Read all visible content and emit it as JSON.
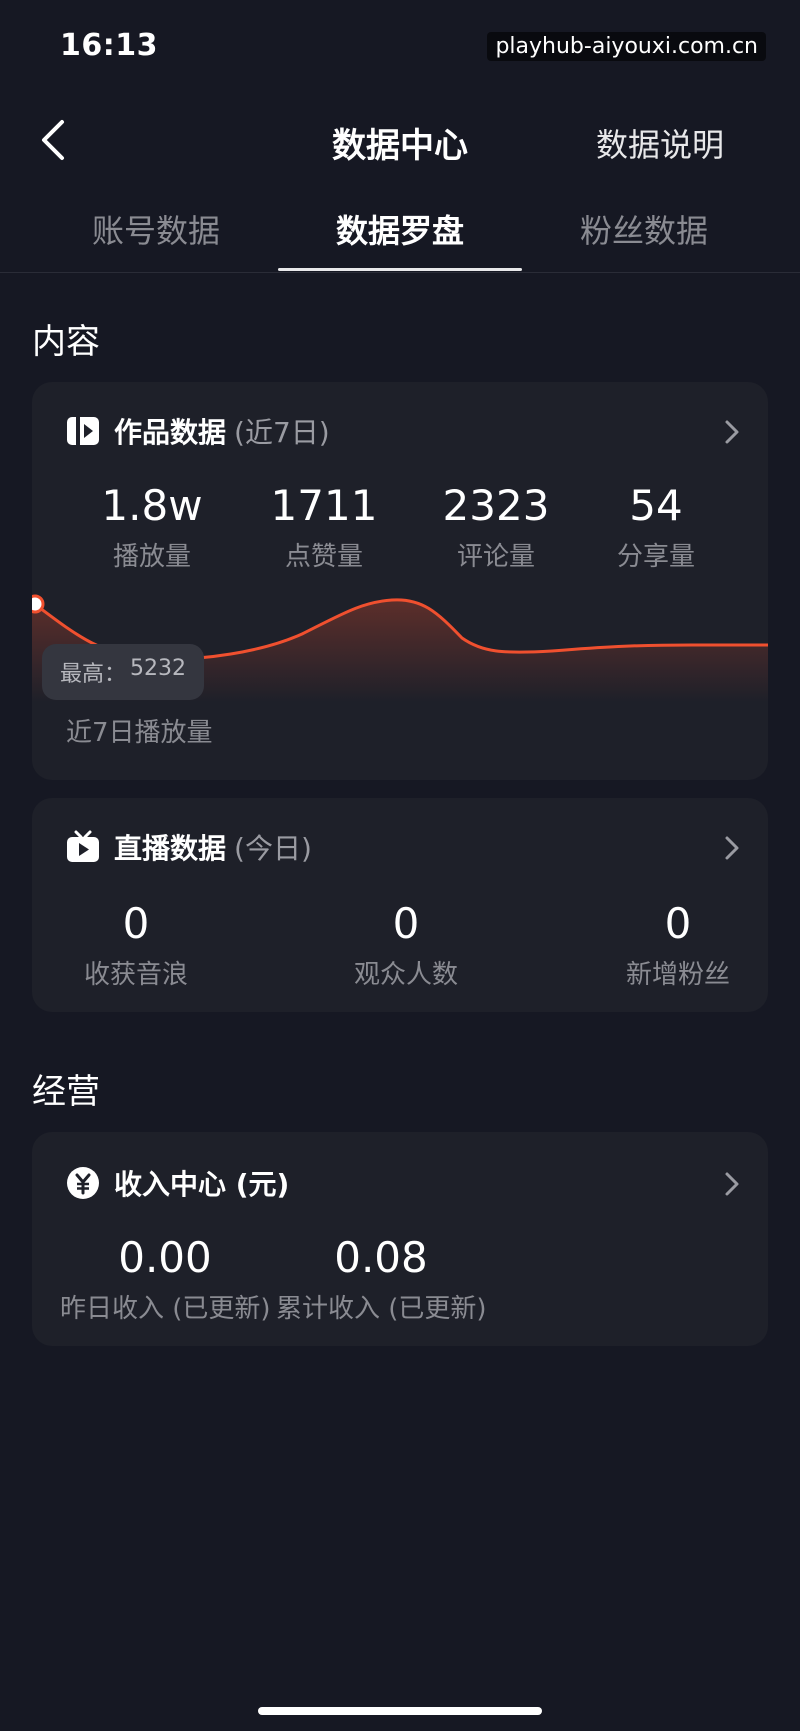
{
  "status": {
    "time": "16:13",
    "watermark": "playhub-aiyouxi.com.cn"
  },
  "header": {
    "title": "数据中心",
    "right_link": "数据说明"
  },
  "tabs": [
    {
      "label": "账号数据",
      "active": false
    },
    {
      "label": "数据罗盘",
      "active": true
    },
    {
      "label": "粉丝数据",
      "active": false
    }
  ],
  "content_section": {
    "title": "内容"
  },
  "works_card": {
    "title": "作品数据",
    "suffix": "(近7日)",
    "metrics": [
      {
        "value": "1.8w",
        "label": "播放量"
      },
      {
        "value": "1711",
        "label": "点赞量"
      },
      {
        "value": "2323",
        "label": "评论量"
      },
      {
        "value": "54",
        "label": "分享量"
      }
    ],
    "chart": {
      "tooltip_label": "最高：",
      "tooltip_value": "5232",
      "caption": "近7日播放量",
      "line_color": "#f0502f"
    }
  },
  "live_card": {
    "title": "直播数据",
    "suffix": "(今日)",
    "metrics": [
      {
        "value": "0",
        "label": "收获音浪"
      },
      {
        "value": "0",
        "label": "观众人数"
      },
      {
        "value": "0",
        "label": "新增粉丝"
      }
    ]
  },
  "business_section": {
    "title": "经营"
  },
  "income_card": {
    "title": "收入中心 (元)",
    "metrics": [
      {
        "value": "0.00",
        "label": "昨日收入 (已更新)"
      },
      {
        "value": "0.08",
        "label": "累计收入 (已更新)"
      }
    ]
  },
  "icons": {
    "back": "chevron-left-icon",
    "works": "video-icon",
    "live": "tv-icon",
    "income": "yuan-icon",
    "chevron": "chevron-right-icon"
  },
  "colors": {
    "background": "#161823",
    "card": "#1e2029",
    "accent_line": "#f0502f",
    "muted_text": "#8a8b92"
  }
}
